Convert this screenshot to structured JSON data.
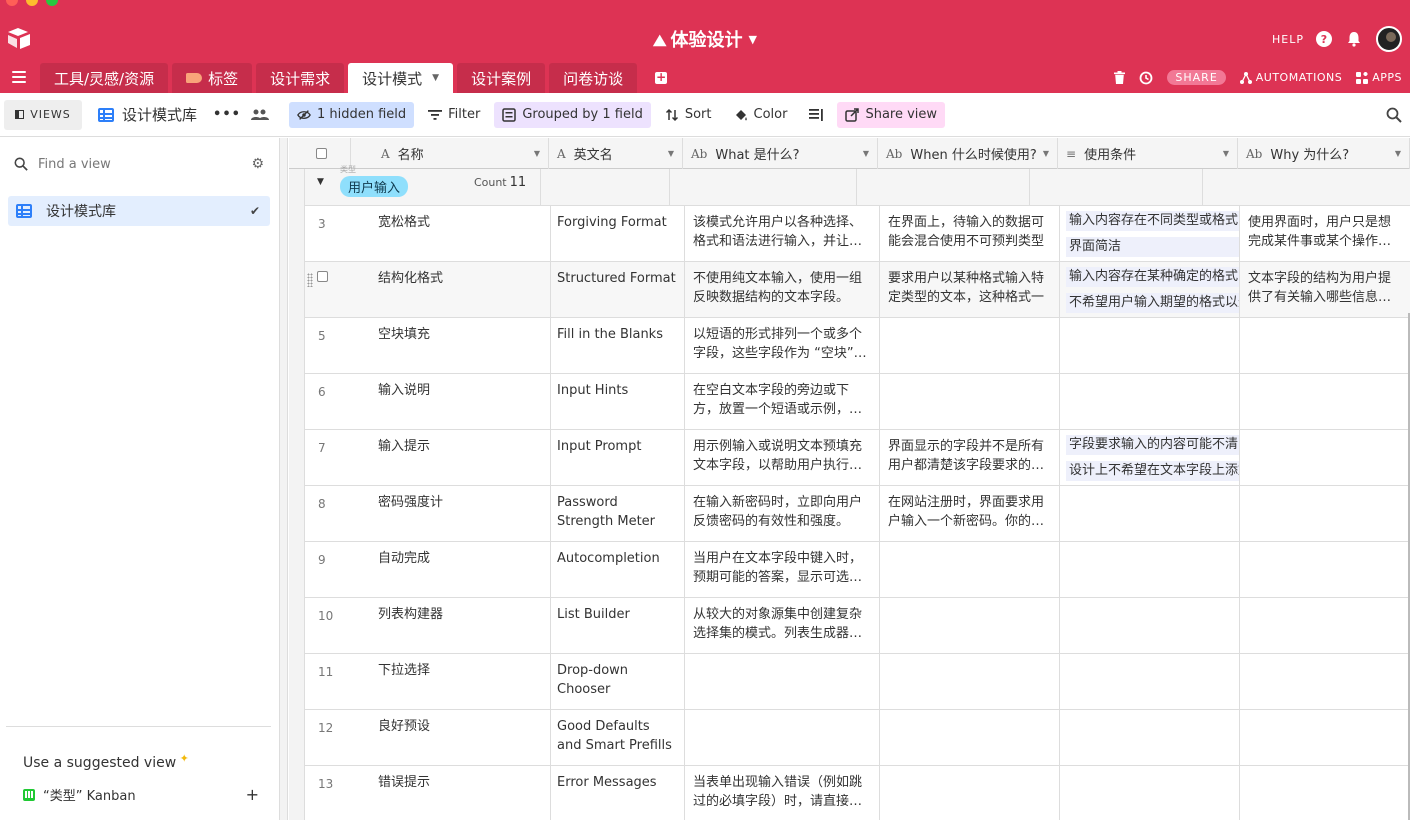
{
  "app": {
    "base_title": "体验设计",
    "help_label": "HELP",
    "colors": {
      "brand": "#dd3354",
      "accent": "#2d7ff9",
      "group_pill": "#8fdffc"
    }
  },
  "tabs": [
    {
      "label": "工具/灵感/资源"
    },
    {
      "label": "标签"
    },
    {
      "label": "设计需求"
    },
    {
      "label": "设计模式",
      "active": true
    },
    {
      "label": "设计案例"
    },
    {
      "label": "问卷访谈"
    }
  ],
  "tabbar_right": {
    "share": "SHARE",
    "automations": "AUTOMATIONS",
    "apps": "APPS"
  },
  "viewbar": {
    "views_label": "VIEWS",
    "view_name": "设计模式库",
    "hidden_field": "1 hidden field",
    "filter": "Filter",
    "grouped": "Grouped by 1 field",
    "sort": "Sort",
    "color": "Color",
    "share_view": "Share view"
  },
  "sidebar": {
    "find_placeholder": "Find a view",
    "views": [
      {
        "label": "设计模式库",
        "selected": true
      }
    ],
    "suggest_title": "Use a suggested view",
    "suggestions": [
      {
        "label": "“类型” Kanban"
      }
    ]
  },
  "columns": [
    {
      "label": "名称",
      "type_icon": "A"
    },
    {
      "label": "英文名",
      "type_icon": "A"
    },
    {
      "label": "What 是什么?",
      "type_icon": "Ab"
    },
    {
      "label": "When 什么时候使用?",
      "type_icon": "Ab"
    },
    {
      "label": "使用条件",
      "type_icon": "≡"
    },
    {
      "label": "Why 为什么?",
      "type_icon": "Ab"
    }
  ],
  "group": {
    "field_label": "类型",
    "value": "用户输入",
    "count_label": "Count",
    "count": "11"
  },
  "rows": [
    {
      "num": "3",
      "name": "宽松格式",
      "en": "Forgiving Format",
      "what": "该模式允许用户以各种选择、格式和语法进行输入，并让…",
      "when": "在界面上，待输入的数据可能会混合使用不可预判类型",
      "cond": [
        "输入内容存在不同类型或格式",
        "界面简洁"
      ],
      "why": "使用界面时，用户只是想完成某件事或某个操作，而不"
    },
    {
      "num": "",
      "name": "结构化格式",
      "en": "Structured Format",
      "what": "不使用纯文本输入，使用一组反映数据结构的文本字段。",
      "when": "要求用户以某种格式输入特定类型的文本，这种格式一",
      "cond": [
        "输入内容存在某种确定的格式",
        "不希望用户输入期望的格式以外"
      ],
      "why": "文本字段的结构为用户提供了有关输入哪些信息的线"
    },
    {
      "num": "5",
      "name": "空块填充",
      "en": "Fill in the Blanks",
      "what": "以短语的形式排列一个或多个字段，这些字段作为 “空块”…",
      "when": "",
      "cond": [],
      "why": ""
    },
    {
      "num": "6",
      "name": "输入说明",
      "en": "Input Hints",
      "what": "在空白文本字段的旁边或下方，放置一个短语或示例，…",
      "when": "",
      "cond": [],
      "why": ""
    },
    {
      "num": "7",
      "name": "输入提示",
      "en": "Input Prompt",
      "what": "用示例输入或说明文本预填充文本字段，以帮助用户执行…",
      "when": "界面显示的字段并不是所有用户都清楚该字段要求的…",
      "cond": [
        "字段要求输入的内容可能不清",
        "设计上不希望在文本字段上添加"
      ],
      "why": ""
    },
    {
      "num": "8",
      "name": "密码强度计",
      "en": "Password Strength Meter",
      "what": "在输入新密码时，立即向用户反馈密码的有效性和强度。",
      "when": "在网站注册时，界面要求用户输入一个新密码。你的…",
      "cond": [],
      "why": ""
    },
    {
      "num": "9",
      "name": "自动完成",
      "en": "Autocompletion",
      "what": "当用户在文本字段中键入时，预期可能的答案，显示可选…",
      "when": "",
      "cond": [],
      "why": ""
    },
    {
      "num": "10",
      "name": "列表构建器",
      "en": "List Builder",
      "what": "从较大的对象源集中创建复杂选择集的模式。列表生成器…",
      "when": "",
      "cond": [],
      "why": ""
    },
    {
      "num": "11",
      "name": "下拉选择",
      "en": "Drop-down Chooser",
      "what": "",
      "when": "",
      "cond": [],
      "why": ""
    },
    {
      "num": "12",
      "name": "良好预设",
      "en": "Good Defaults and Smart Prefills",
      "what": "",
      "when": "",
      "cond": [],
      "why": ""
    },
    {
      "num": "13",
      "name": "错误提示",
      "en": "Error Messages",
      "what": "当表单出现输入错误（例如跳过的必填字段）时，请直接…",
      "when": "",
      "cond": [],
      "why": ""
    }
  ]
}
